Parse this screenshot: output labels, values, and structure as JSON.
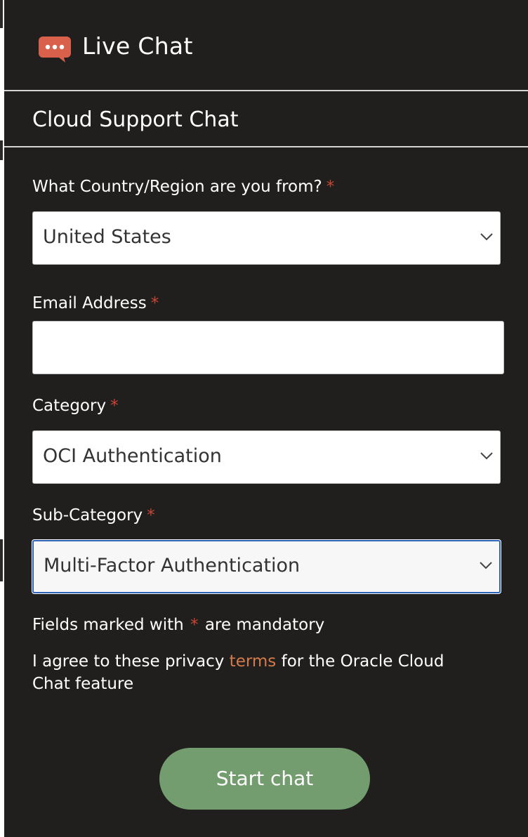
{
  "header": {
    "title": "Live Chat",
    "icon": "chat-bubble-icon",
    "icon_color": "#d9604a"
  },
  "form": {
    "title": "Cloud Support Chat",
    "required_marker": "*",
    "country": {
      "label": "What Country/Region are you from?",
      "value": "United States"
    },
    "email": {
      "label": "Email Address",
      "value": ""
    },
    "category": {
      "label": "Category",
      "value": "OCI Authentication"
    },
    "subcategory": {
      "label": "Sub-Category",
      "value": "Multi-Factor Authentication"
    },
    "mandatory_note": {
      "before": "Fields marked with",
      "marker": "*",
      "after": "are mandatory"
    },
    "privacy": {
      "before": "I agree to these privacy",
      "link": "terms",
      "after": "for the Oracle Cloud Chat feature"
    },
    "start_button": "Start chat"
  },
  "colors": {
    "background": "#201f1e",
    "required": "#c74634",
    "link": "#d37b4a",
    "button": "#749d6f",
    "focus": "#2d62b8"
  }
}
